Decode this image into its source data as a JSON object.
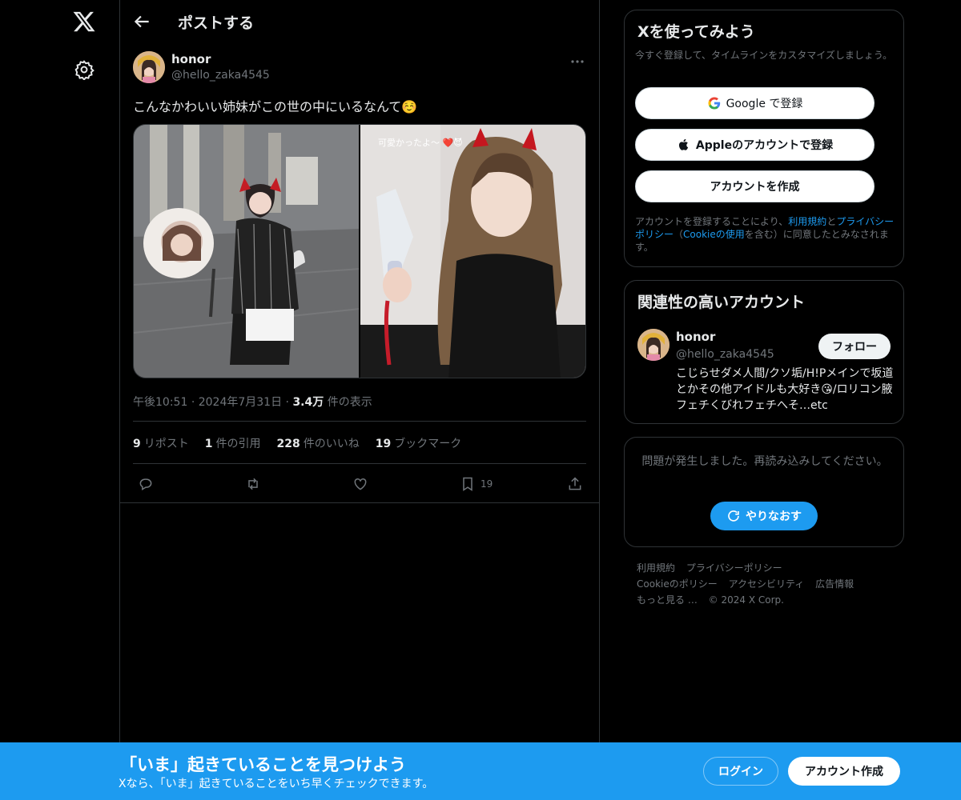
{
  "header": {
    "title": "ポストする"
  },
  "post": {
    "author_name": "honor",
    "author_handle": "@hello_zaka4545",
    "text": "こんなかわいい姉妹がこの世の中にいるなんて☺️",
    "photo_overlay_text": "可愛かったよ〜 ❤️😈",
    "time": "午後10:51",
    "date": "2024年7月31日",
    "views_value": "3.4万",
    "views_label": "件の表示",
    "stats": {
      "reposts_count": "9",
      "reposts_label": "リポスト",
      "quotes_count": "1",
      "quotes_label": "件の引用",
      "likes_count": "228",
      "likes_label": "件のいいね",
      "bookmarks_count": "19",
      "bookmarks_label": "ブックマーク"
    },
    "bookmark_action_count": "19"
  },
  "signup_card": {
    "title": "Xを使ってみよう",
    "subtitle": "今すぐ登録して、タイムラインをカスタマイズしましょう。",
    "google_label": "Google で登録",
    "apple_label": "Appleのアカウントで登録",
    "create_label": "アカウントを作成",
    "legal_prefix": "アカウントを登録することにより、",
    "legal_terms": "利用規約",
    "legal_and": "と",
    "legal_privacy": "プライバシーポリシー",
    "legal_open": "（",
    "legal_cookie": "Cookieの使用",
    "legal_suffix": "を含む）に同意したとみなされます。"
  },
  "relevant_card": {
    "title": "関連性の高いアカウント",
    "name": "honor",
    "handle": "@hello_zaka4545",
    "follow_label": "フォロー",
    "bio": "こじらせダメ人間/クソ垢/H!Pメインで坂道とかその他アイドルも大好き😘/ロリコン腋フェチくびれフェチへそ…etc"
  },
  "error_card": {
    "message": "問題が発生しました。再読み込みしてください。",
    "retry_label": "やりなおす"
  },
  "footer": {
    "terms": "利用規約",
    "privacy": "プライバシーポリシー",
    "cookie": "Cookieのポリシー",
    "accessibility": "アクセシビリティ",
    "ads": "広告情報",
    "more": "もっと見る …",
    "copyright": "© 2024 X Corp."
  },
  "banner": {
    "title": "「いま」起きていることを見つけよう",
    "subtitle": "Xなら、「いま」起きていることをいち早くチェックできます。",
    "login_label": "ログイン",
    "signup_label": "アカウント作成"
  },
  "colors": {
    "accent": "#1d9bf0",
    "background": "#000000",
    "border": "#2f3336",
    "muted": "#71767b"
  },
  "icons": [
    "x-logo-icon",
    "settings-gear-icon",
    "back-arrow-icon",
    "more-dots-icon",
    "reply-icon",
    "repost-icon",
    "like-icon",
    "bookmark-icon",
    "share-icon",
    "google-icon",
    "apple-icon",
    "refresh-icon"
  ]
}
